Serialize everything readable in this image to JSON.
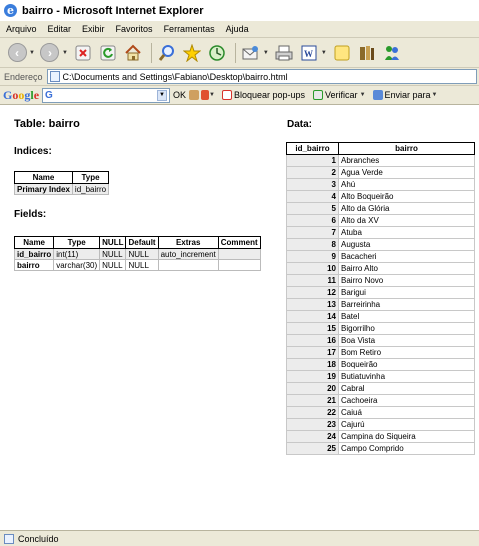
{
  "window": {
    "title": "bairro - Microsoft Internet Explorer"
  },
  "menu": [
    "Arquivo",
    "Editar",
    "Exibir",
    "Favoritos",
    "Ferramentas",
    "Ajuda"
  ],
  "address": {
    "label": "Endereço",
    "value": "C:\\Documents and Settings\\Fabiano\\Desktop\\bairro.html"
  },
  "google_bar": {
    "logo": "Google",
    "search_prefix": "G",
    "ok_label": "OK",
    "popup_label": "Bloquear pop-ups",
    "spell_label": "Verificar",
    "send_label": "Enviar para"
  },
  "page": {
    "title": "Table: bairro",
    "indices_heading": "Indices:",
    "fields_heading": "Fields:",
    "data_heading": "Data:"
  },
  "indices": {
    "headers": [
      "Name",
      "Type"
    ],
    "rows": [
      [
        "Primary Index",
        "id_bairro"
      ]
    ]
  },
  "fields": {
    "headers": [
      "Name",
      "Type",
      "NULL",
      "Default",
      "Extras",
      "Comment"
    ],
    "rows": [
      [
        "id_bairro",
        "int(11)",
        "NULL",
        "NULL",
        "auto_increment",
        ""
      ],
      [
        "bairro",
        "varchar(30)",
        "NULL",
        "NULL",
        "",
        ""
      ]
    ]
  },
  "data": {
    "headers": [
      "id_bairro",
      "bairro"
    ],
    "rows": [
      [
        "1",
        "Abranches"
      ],
      [
        "2",
        "Agua Verde"
      ],
      [
        "3",
        "Ahú"
      ],
      [
        "4",
        "Alto Boqueirão"
      ],
      [
        "5",
        "Alto da Glória"
      ],
      [
        "6",
        "Alto da XV"
      ],
      [
        "7",
        "Atuba"
      ],
      [
        "8",
        "Augusta"
      ],
      [
        "9",
        "Bacacheri"
      ],
      [
        "10",
        "Bairro Alto"
      ],
      [
        "11",
        "Bairro Novo"
      ],
      [
        "12",
        "Barigui"
      ],
      [
        "13",
        "Barreirinha"
      ],
      [
        "14",
        "Batel"
      ],
      [
        "15",
        "Bigorrilho"
      ],
      [
        "16",
        "Boa Vista"
      ],
      [
        "17",
        "Bom Retiro"
      ],
      [
        "18",
        "Boqueirão"
      ],
      [
        "19",
        "Butiatuvinha"
      ],
      [
        "20",
        "Cabral"
      ],
      [
        "21",
        "Cachoeira"
      ],
      [
        "22",
        "Caiuá"
      ],
      [
        "23",
        "Cajurú"
      ],
      [
        "24",
        "Campina do Siqueira"
      ],
      [
        "25",
        "Campo Comprido"
      ]
    ]
  },
  "status": {
    "text": "Concluído"
  }
}
